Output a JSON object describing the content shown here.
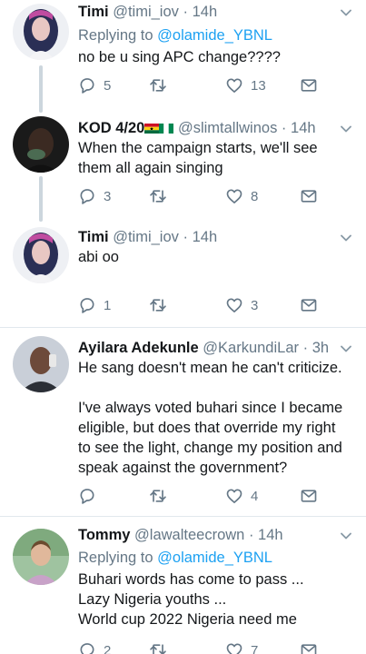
{
  "tweets": [
    {
      "name": "Timi",
      "handle": "@timi_iov",
      "time": "14h",
      "replying_label": "Replying to",
      "replying_to": "@olamide_YBNL",
      "text_lines": [
        "no be u sing APC change????"
      ],
      "replies": "5",
      "retweets": "",
      "likes": "13"
    },
    {
      "name": "KOD 4/20",
      "handle": "@slimtallwinos",
      "time": "14h",
      "text_lines": [
        "When the campaign starts, we'll see",
        "them all again singing"
      ],
      "replies": "3",
      "retweets": "",
      "likes": "8"
    },
    {
      "name": "Timi",
      "handle": "@timi_iov",
      "time": "14h",
      "text_lines": [
        "abi oo"
      ],
      "replies": "1",
      "retweets": "",
      "likes": "3"
    },
    {
      "name": "Ayilara Adekunle",
      "handle": "@KarkundiLar",
      "time": "3h",
      "text_lines": [
        "He sang doesn't mean he can't criticize.",
        "",
        "I've always voted buhari since I became",
        "eligible, but does that override my right",
        "to see the light, change my position and",
        "speak against the government?"
      ],
      "replies": "",
      "retweets": "",
      "likes": "4"
    },
    {
      "name": "Tommy",
      "handle": "@lawalteecrown",
      "time": "14h",
      "replying_label": "Replying to",
      "replying_to": "@olamide_YBNL",
      "text_lines": [
        "Buhari words has come to pass ...",
        "Lazy Nigeria youths ...",
        "World cup 2022 Nigeria need me"
      ],
      "replies": "2",
      "retweets": "",
      "likes": "7"
    }
  ],
  "separator": "·",
  "colors": {
    "text": "#14171a",
    "secondary": "#657786",
    "link": "#1da1f2",
    "thread_line": "#ccd6dd",
    "divider": "#e1e8ed"
  },
  "icons": {
    "reply": "reply-icon",
    "retweet": "retweet-icon",
    "like": "heart-icon",
    "dm": "envelope-icon",
    "menu": "chevron-down-icon"
  }
}
